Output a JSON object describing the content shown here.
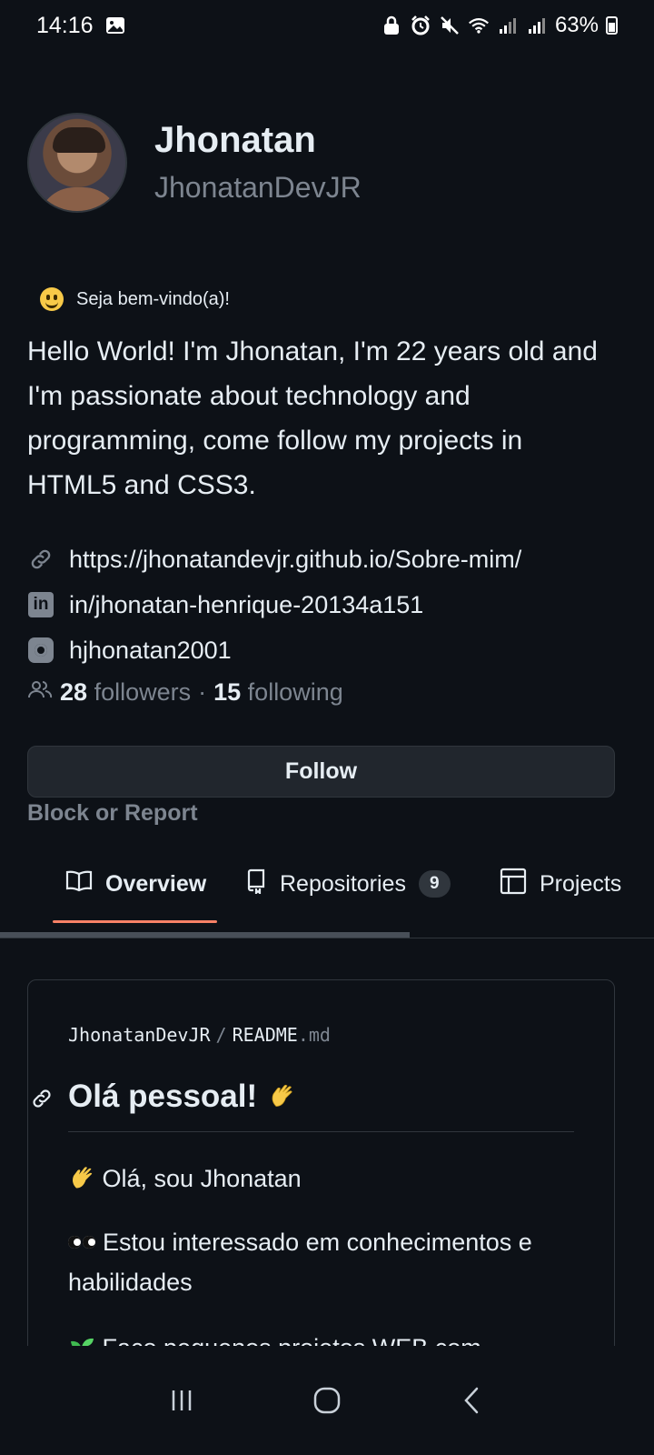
{
  "status_bar": {
    "time": "14:16",
    "battery": "63%",
    "icons": [
      "image-icon",
      "lock-icon",
      "alarm-icon",
      "mute-icon",
      "wifi-icon",
      "signal-icon",
      "signal-icon",
      "battery-icon"
    ]
  },
  "profile": {
    "name": "Jhonatan",
    "username": "JhonatanDevJR",
    "status_text": "Seja bem-vindo(a)!",
    "bio": "Hello World! I'm Jhonatan, I'm 22 years old and I'm passionate about technology and programming, come follow my projects in HTML5 and CSS3.",
    "links": [
      {
        "icon": "link-icon",
        "text": "https://jhonatandevjr.github.io/Sobre-mim/"
      },
      {
        "icon": "linkedin-icon",
        "text": "in/jhonatan-henrique-20134a151"
      },
      {
        "icon": "instagram-icon",
        "text": "hjhonatan2001"
      }
    ],
    "followers_count": "28",
    "followers_label": "followers",
    "separator": "·",
    "following_count": "15",
    "following_label": "following",
    "follow_button": "Follow",
    "block_report": "Block or Report"
  },
  "tabs": [
    {
      "label": "Overview",
      "icon": "book-icon",
      "active": true
    },
    {
      "label": "Repositories",
      "icon": "repo-icon",
      "count": "9"
    },
    {
      "label": "Projects",
      "icon": "table-icon"
    }
  ],
  "readme": {
    "owner": "JhonatanDevJR",
    "sep": "/",
    "file_name": "README",
    "file_ext": ".md",
    "title": "Olá pessoal!",
    "lines": [
      "Olá, sou Jhonatan",
      "Estou interessado em conhecimentos e habilidades",
      "Faço pequenos projetos WEB com"
    ]
  },
  "nav": {
    "recents": "recents-icon",
    "home": "home-icon",
    "back": "back-icon"
  },
  "colors": {
    "background": "#0d1117",
    "border": "#30363d",
    "muted": "#7d8590",
    "accent_underline": "#f78166"
  }
}
